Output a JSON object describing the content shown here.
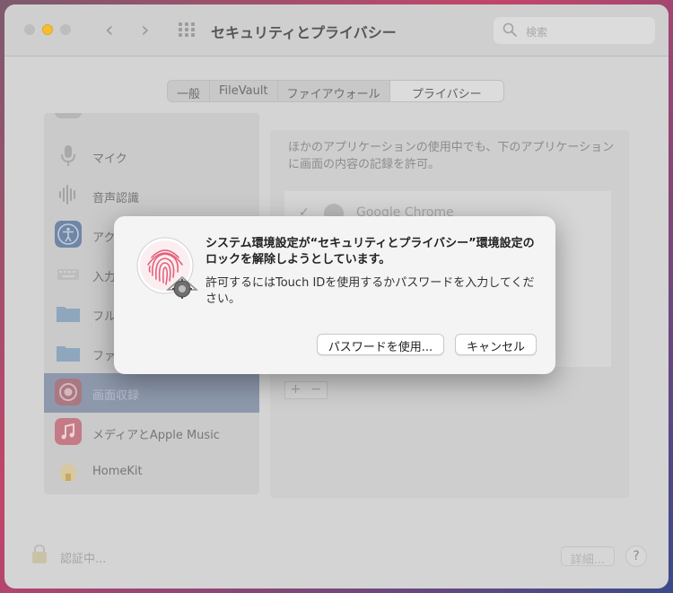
{
  "window": {
    "title": "セキュリティとプライバシー",
    "search_placeholder": "検索"
  },
  "tabs": [
    {
      "label": "一般",
      "active": false
    },
    {
      "label": "FileVault",
      "active": false
    },
    {
      "label": "ファイアウォール",
      "active": false
    },
    {
      "label": "プライバシー",
      "active": true
    }
  ],
  "sidebar": {
    "items": [
      {
        "label": "",
        "icon": "partial-item-icon"
      },
      {
        "label": "マイク",
        "icon": "microphone-icon"
      },
      {
        "label": "音声認識",
        "icon": "waveform-icon"
      },
      {
        "label": "アク",
        "icon": "accessibility-icon"
      },
      {
        "label": "入力",
        "icon": "keyboard-icon"
      },
      {
        "label": "フル",
        "icon": "folder-icon"
      },
      {
        "label": "ファ",
        "icon": "folder-icon"
      },
      {
        "label": "画面収録",
        "icon": "screen-record-icon",
        "selected": true
      },
      {
        "label": "メディアとApple Music",
        "icon": "music-icon"
      },
      {
        "label": "HomeKit",
        "icon": "home-icon"
      }
    ]
  },
  "main": {
    "description": "ほかのアプリケーションの使用中でも、下のアプリケーションに画面の内容の記録を許可。",
    "apps": [
      {
        "name": "Google Chrome",
        "checked": true
      }
    ],
    "add_label": "+",
    "remove_label": "−"
  },
  "footer": {
    "lock_text": "認証中...",
    "details_label": "詳細...",
    "help_label": "?"
  },
  "dialog": {
    "title": "システム環境設定が“セキュリティとプライバシー”環境設定のロックを解除しようとしています。",
    "message": "許可するにはTouch IDを使用するかパスワードを入力してください。",
    "use_password_label": "パスワードを使用...",
    "cancel_label": "キャンセル"
  },
  "colors": {
    "selection": "#8d98ac",
    "minimize": "#f6be2f",
    "fingerprint": "#e4607a"
  }
}
